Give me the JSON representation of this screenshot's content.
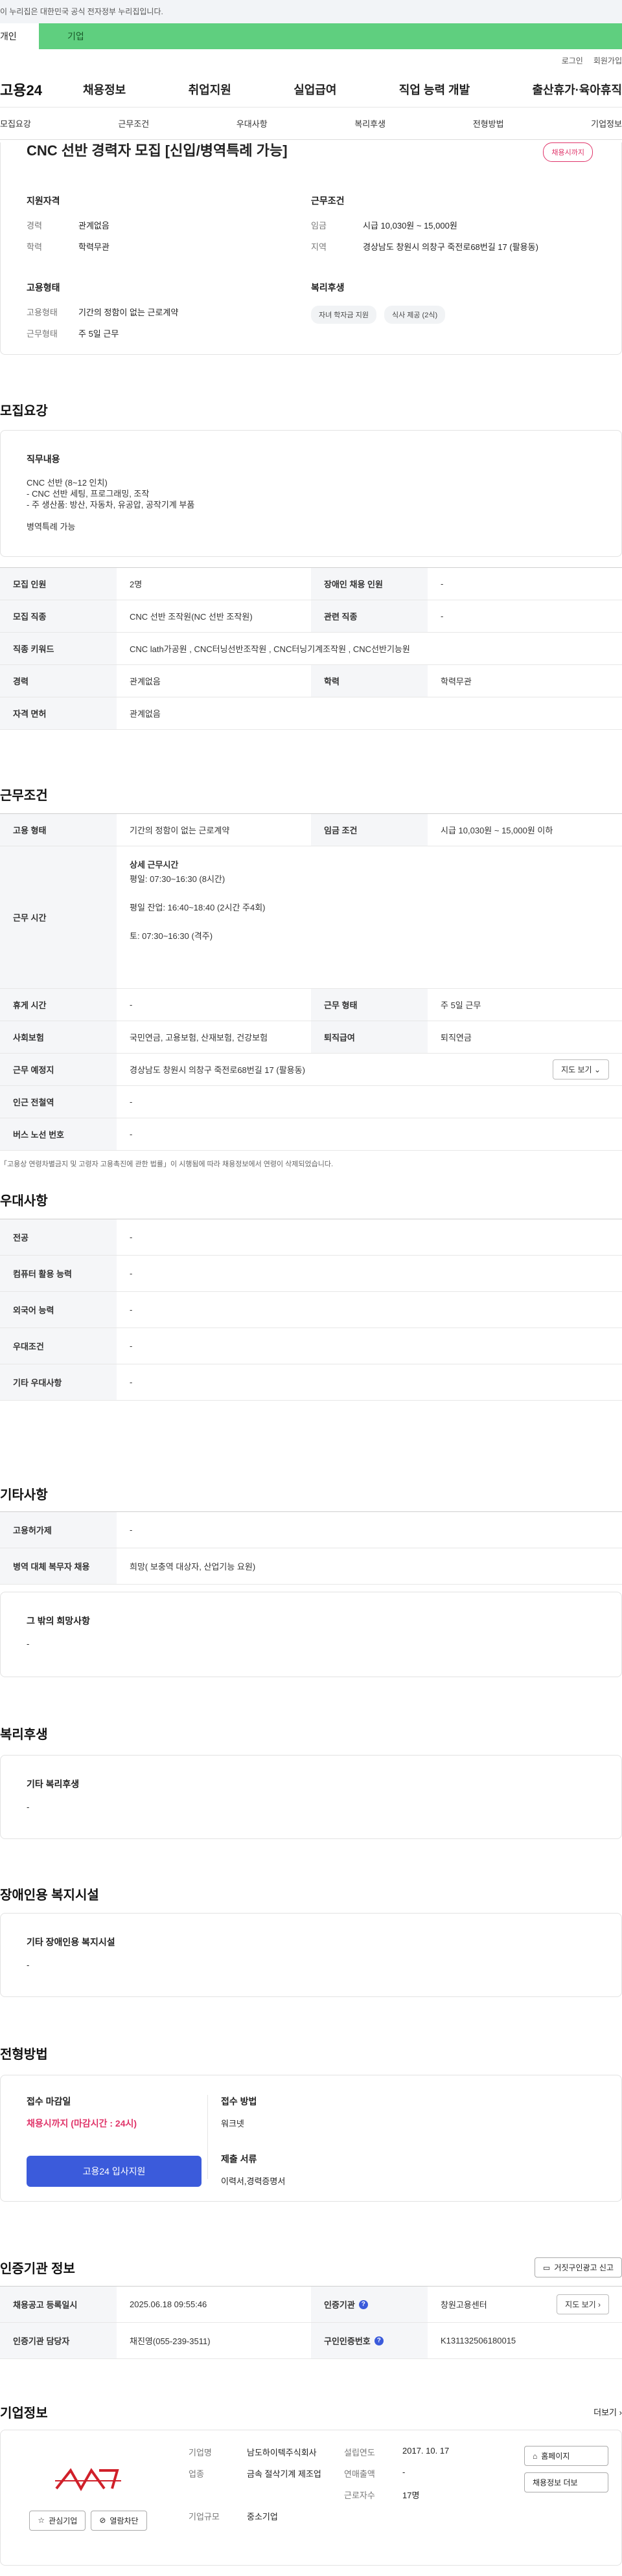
{
  "notice": "이 누리집은 대한민국 공식 전자정부 누리집입니다.",
  "tabs": [
    "개인",
    "기업"
  ],
  "util": [
    "로그인",
    "회원가입"
  ],
  "logo": "고용24",
  "gnb": [
    "채용정보",
    "취업지원",
    "실업급여",
    "직업 능력 개발",
    "출산휴가·육아휴직"
  ],
  "anchors": [
    "모집요강",
    "근무조건",
    "우대사항",
    "복리후생",
    "전형방법",
    "기업정보"
  ],
  "header": {
    "title": "CNC 선반 경력자 모집 [신입/병역특례 가능]",
    "badge": "채용시까지",
    "qual_title": "지원자격",
    "qual": [
      {
        "k": "경력",
        "v": "관계없음"
      },
      {
        "k": "학력",
        "v": "학력무관"
      }
    ],
    "cond_title": "근무조건",
    "cond": [
      {
        "k": "임금",
        "v": "시급 10,030원 ~ 15,000원"
      },
      {
        "k": "지역",
        "v": "경상남도 창원시 의창구 죽전로68번길 17 (팔용동)"
      }
    ],
    "emp_title": "고용형태",
    "emp": [
      {
        "k": "고용형태",
        "v": "기간의 정함이 없는 근로계약"
      },
      {
        "k": "근무형태",
        "v": "주 5일 근무"
      }
    ],
    "welfare_title": "복리후생",
    "welfare_chips": [
      "자녀 학자금 지원",
      "식사 제공 (2식)"
    ]
  },
  "recruit": {
    "title": "모집요강",
    "duty_title": "직무내용",
    "duty_lines": [
      "CNC 선반 (8~12 인치)",
      "- CNC 선반 세팅, 프로그래밍, 조작",
      "- 주 생산품: 방산, 자동차, 유공압, 공작기계 부품",
      "",
      "병역특례 가능"
    ],
    "rows": [
      {
        "k1": "모집 인원",
        "v1": "2명",
        "k2": "장애인 채용 인원",
        "v2": "-"
      },
      {
        "k1": "모집 직종",
        "v1": "CNC 선반 조작원(NC 선반 조작원)",
        "k2": "관련 직종",
        "v2": "-"
      },
      {
        "k1": "직종 키워드",
        "v1": "CNC lath가공원 , CNC터닝선반조작원 , CNC터닝기계조작원 , CNC선반기능원"
      },
      {
        "k1": "경력",
        "v1": "관계없음",
        "k2": "학력",
        "v2": "학력무관"
      },
      {
        "k1": "자격 면허",
        "v1": "관계없음"
      }
    ]
  },
  "work": {
    "title": "근무조건",
    "emp_type_k": "고용 형태",
    "emp_type_v": "기간의 정함이 없는 근로계약",
    "wage_k": "임금 조건",
    "wage_v": "시급 10,030원 ~ 15,000원 이하",
    "hours_k": "근무 시간",
    "hours_lines": [
      "상세 근무시간",
      "평일: 07:30~16:30 (8시간)",
      "",
      "평일 잔업: 16:40~18:40 (2시간 주4회)",
      "",
      "토: 07:30~16:30 (격주)"
    ],
    "rest_k": "휴게 시간",
    "rest_v": "-",
    "form_k": "근무 형태",
    "form_v": "주 5일 근무",
    "ins_k": "사회보험",
    "ins_v": "국민연금, 고용보험, 산재보험, 건강보험",
    "ret_k": "퇴직급여",
    "ret_v": "퇴직연금",
    "loc_k": "근무 예정지",
    "loc_v": "경상남도 창원시 의창구 죽전로68번길 17 (팔용동)",
    "map_btn": "지도 보기",
    "sub_k": "인근 전철역",
    "sub_v": "-",
    "bus_k": "버스 노선 번호",
    "bus_v": "-",
    "note": "「고용상 연령차별금지 및 고령자 고용촉진에 관한 법률」이 시행됨에 따라 채용정보에서 연령이 삭제되었습니다."
  },
  "pref": {
    "title": "우대사항",
    "rows": [
      {
        "k": "전공",
        "v": "-"
      },
      {
        "k": "컴퓨터 활용 능력",
        "v": "-"
      },
      {
        "k": "외국어 능력",
        "v": "-"
      },
      {
        "k": "우대조건",
        "v": "-"
      },
      {
        "k": "기타 우대사항",
        "v": "-"
      }
    ]
  },
  "etc": {
    "title": "기타사항",
    "rows": [
      {
        "k": "고용허가제",
        "v": "-"
      },
      {
        "k": "병역 대체 복무자 채용",
        "v": "희망( 보충역 대상자, 산업기능 요원)"
      }
    ],
    "box_title": "그 밖의 희망사항",
    "box_value": "-"
  },
  "welfare": {
    "title": "복리후생",
    "box_title": "기타 복리후생",
    "box_value": "-"
  },
  "disab": {
    "title": "장애인용 복지시설",
    "box_title": "기타 장애인용 복지시설",
    "box_value": "-"
  },
  "process": {
    "title": "전형방법",
    "deadline_k": "접수 마감일",
    "deadline_v": "채용시까지 (마감시간 : 24시)",
    "apply_btn": "고용24 입사지원",
    "method_k": "접수 방법",
    "method_v": "워크넷",
    "docs_k": "제출 서류",
    "docs_v": "이력서,경력증명서"
  },
  "cert": {
    "title": "인증기관 정보",
    "report_btn": "거짓구인광고 신고",
    "date_k": "채용공고 등록일시",
    "date_v": "2025.06.18 09:55:46",
    "org_k": "인증기관",
    "org_v": "창원고용센터",
    "map_btn": "지도 보기",
    "mgr_k": "인증기관 담당자",
    "mgr_v": "채진영(055-239-3511)",
    "no_k": "구인인증번호",
    "no_v": "K131132506180015"
  },
  "company": {
    "title": "기업정보",
    "more": "더보기",
    "fav_btn": "관심기업",
    "block_btn": "열람차단",
    "name_k": "기업명",
    "name_v": "남도하이텍주식회사",
    "year_k": "설립연도",
    "year_v": "2017. 10. 17",
    "home_btn": "홈페이지",
    "ind_k": "업종",
    "ind_v": "금속 절삭기계 제조업",
    "sales_k": "연매출액",
    "sales_v": "-",
    "emp_k": "근로자수",
    "emp_v": "17명",
    "jobs_btn": "채용정보 더보",
    "size_k": "기업규모",
    "size_v": "중소기업"
  },
  "colors": {
    "accent": "#3b5bdb",
    "badge": "#e0356a",
    "tab_green": "#5fcf7f"
  }
}
